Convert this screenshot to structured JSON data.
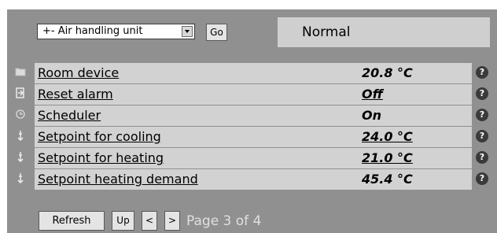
{
  "toolbar": {
    "unit_select_value": "+- Air handling unit",
    "go_label": "Go",
    "status_text": "Normal"
  },
  "rows": [
    {
      "label": "Room device",
      "value": "20.8 °C",
      "icon": "folder-icon"
    },
    {
      "label": "Reset alarm",
      "value": "Off",
      "icon": "exit-icon"
    },
    {
      "label": "Scheduler",
      "value": "On",
      "icon": "clock-icon"
    },
    {
      "label": "Setpoint for cooling",
      "value": "24.0 °C",
      "icon": "setpoint-icon"
    },
    {
      "label": "Setpoint for heating",
      "value": "21.0 °C",
      "icon": "setpoint-icon"
    },
    {
      "label": "Setpoint heating demand",
      "value": "45.4 °C",
      "icon": "setpoint-icon"
    }
  ],
  "help_glyph": "?",
  "footer": {
    "refresh_label": "Refresh",
    "up_label": "Up",
    "prev_label": "<",
    "next_label": ">",
    "page_text": "Page 3 of 4"
  }
}
